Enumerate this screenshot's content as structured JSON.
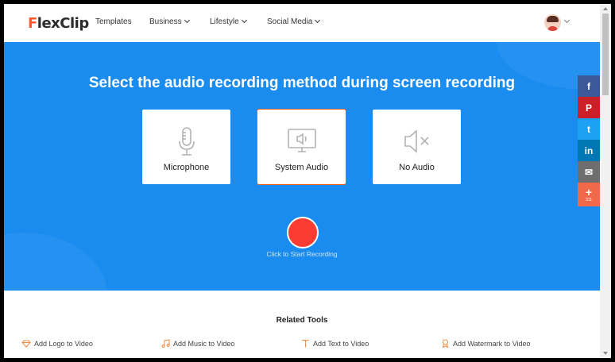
{
  "header": {
    "logo_first": "F",
    "logo_rest": "lexClip",
    "nav": [
      {
        "label": "Templates"
      },
      {
        "label": "Business"
      },
      {
        "label": "Lifestyle"
      },
      {
        "label": "Social Media"
      }
    ]
  },
  "hero": {
    "title": "Select the audio recording method during screen recording",
    "options": [
      {
        "label": "Microphone",
        "icon": "microphone-icon"
      },
      {
        "label": "System Audio",
        "icon": "system-audio-icon",
        "selected": true
      },
      {
        "label": "No Audio",
        "icon": "mute-icon"
      }
    ],
    "record_label": "Click to Start Recording"
  },
  "related": {
    "title": "Related Tools",
    "tools": [
      {
        "label": "Add Logo to Video",
        "icon": "diamond-icon"
      },
      {
        "label": "Add Music to Video",
        "icon": "music-note-icon"
      },
      {
        "label": "Add Text to Video",
        "icon": "text-icon"
      },
      {
        "label": "Add Watermark to Video",
        "icon": "watermark-icon"
      }
    ]
  },
  "social": [
    {
      "name": "facebook",
      "glyph": "f",
      "color": "#3b5998"
    },
    {
      "name": "pinterest",
      "glyph": "P",
      "color": "#cb2027"
    },
    {
      "name": "twitter",
      "glyph": "t",
      "color": "#1da1f2"
    },
    {
      "name": "linkedin",
      "glyph": "in",
      "color": "#0077b5"
    },
    {
      "name": "email",
      "glyph": "✉",
      "color": "#6e6e6e"
    },
    {
      "name": "more",
      "glyph": "+",
      "count": "311",
      "color": "#f06a4a"
    }
  ],
  "colors": {
    "brand_blue": "#1a8cf0",
    "record_red": "#fb3c33",
    "selected_border": "#f05a1a",
    "logo_accent": "#ff5b2e"
  }
}
